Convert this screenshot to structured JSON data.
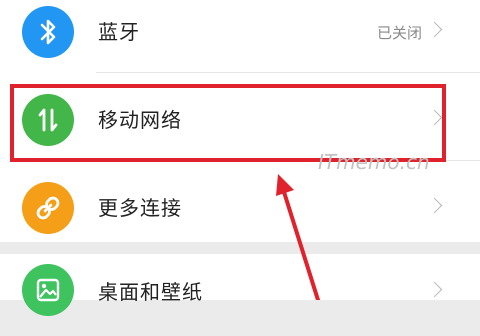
{
  "settings": {
    "items": [
      {
        "label": "蓝牙",
        "status": "已关闭",
        "icon": "bluetooth-icon",
        "icon_color": "#2196f3"
      },
      {
        "label": "移动网络",
        "status": "",
        "icon": "mobile-data-icon",
        "icon_color": "#43b649"
      },
      {
        "label": "更多连接",
        "status": "",
        "icon": "link-icon",
        "icon_color": "#f59e17"
      },
      {
        "label": "桌面和壁纸",
        "status": "",
        "icon": "wallpaper-icon",
        "icon_color": "#3ec35e"
      }
    ]
  },
  "annotation": {
    "watermark": "ITmemo.cn",
    "highlight_color": "#e0222c"
  }
}
